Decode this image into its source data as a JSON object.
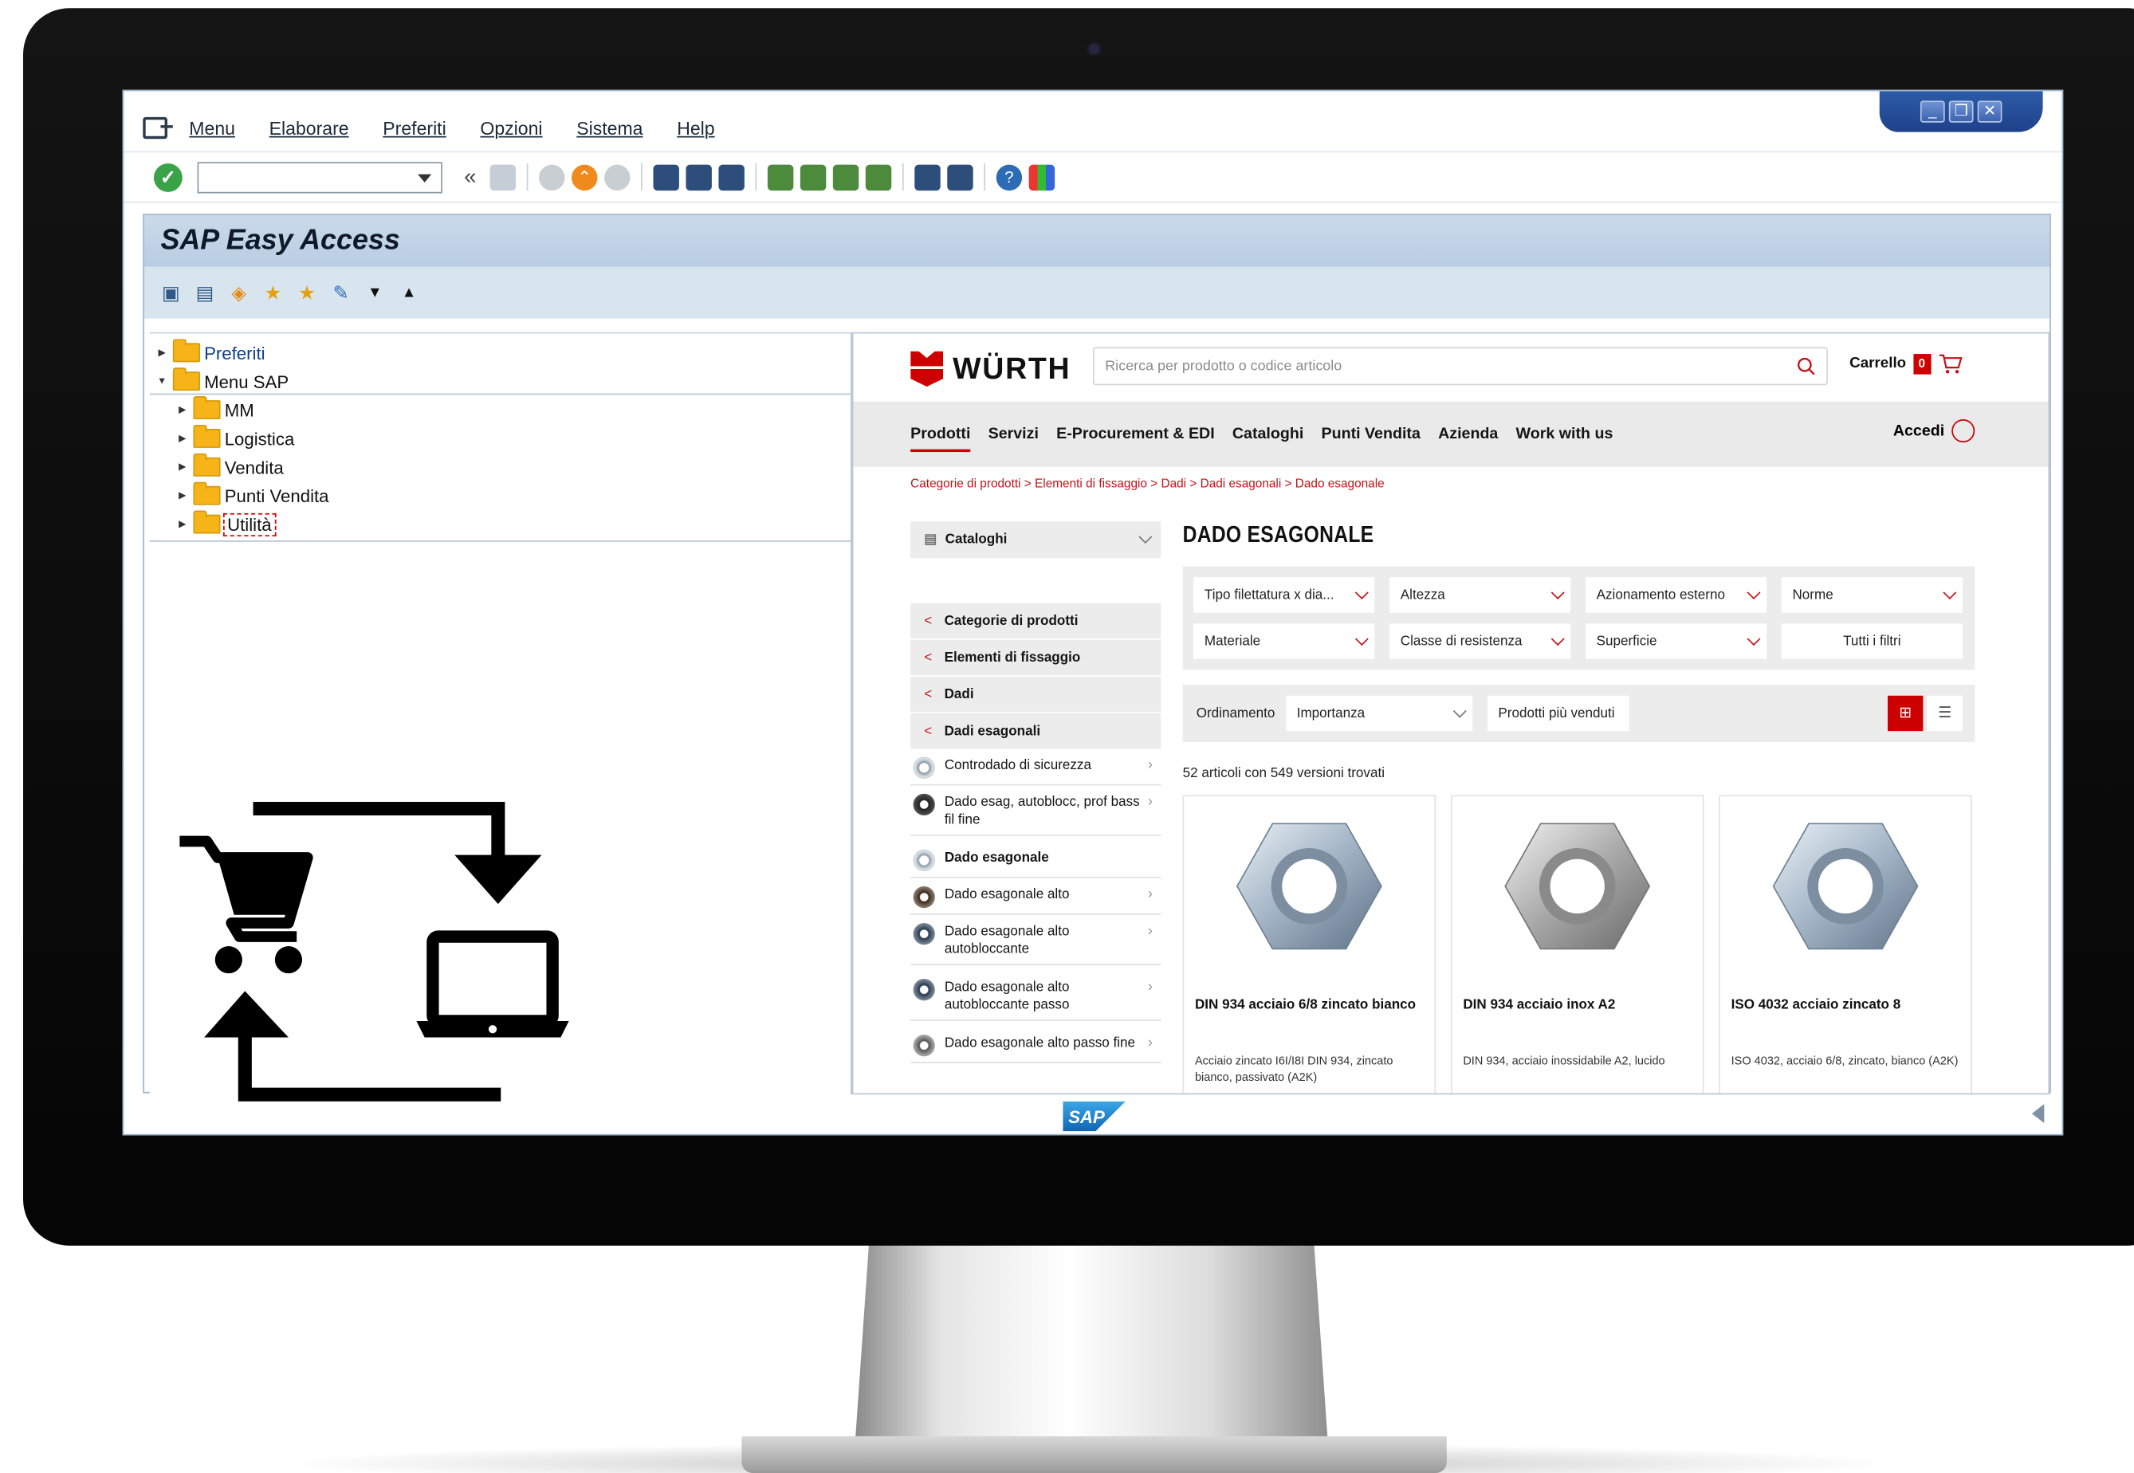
{
  "menubar": {
    "items": [
      "Menu",
      "Elaborare",
      "Preferiti",
      "Opzioni",
      "Sistema",
      "Help"
    ]
  },
  "sap": {
    "title": "SAP Easy Access",
    "tree": [
      {
        "label": "Preferiti",
        "level": 0,
        "open": false
      },
      {
        "label": "Menu SAP",
        "level": 0,
        "open": true
      },
      {
        "label": "MM",
        "level": 1,
        "open": false
      },
      {
        "label": "Logistica",
        "level": 1,
        "open": false
      },
      {
        "label": "Vendita",
        "level": 1,
        "open": false
      },
      {
        "label": "Punti Vendita",
        "level": 1,
        "open": false
      },
      {
        "label": "Utilità",
        "level": 1,
        "open": false
      }
    ],
    "logo": "SAP"
  },
  "web": {
    "logo_text": "WÜRTH",
    "search_placeholder": "Ricerca per prodotto o codice articolo",
    "cart_label": "Carrello",
    "cart_count": "0",
    "nav": [
      "Prodotti",
      "Servizi",
      "E-Procurement & EDI",
      "Cataloghi",
      "Punti Vendita",
      "Azienda",
      "Work with us"
    ],
    "login_label": "Accedi",
    "breadcrumb": "Categorie di prodotti  >  Elementi di fissaggio  >  Dadi  >  Dadi esagonali  >  Dado esagonale",
    "side_dropdown": "Cataloghi",
    "side_nav": [
      "Categorie di prodotti",
      "Elementi di fissaggio",
      "Dadi",
      "Dadi esagonali"
    ],
    "side_items": [
      "Controdado di sicurezza",
      "Dado esag, autoblocc, prof bass fil fine",
      "Dado esagonale",
      "Dado esagonale alto",
      "Dado esagonale alto autobloccante",
      "Dado esagonale alto autobloccante passo",
      "Dado esagonale alto passo fine"
    ],
    "heading": "DADO ESAGONALE",
    "filters": [
      "Tipo filettatura x dia...",
      "Altezza",
      "Azionamento esterno",
      "Norme",
      "Materiale",
      "Classe di resistenza",
      "Superficie",
      "Tutti i filtri"
    ],
    "sort_label": "Ordinamento",
    "sort_value": "Importanza",
    "bestsellers": "Prodotti più venduti",
    "result_count": "52 articoli con 549 versioni trovati",
    "products": [
      {
        "name": "DIN 934 acciaio 6/8 zincato bianco",
        "desc": "Acciaio zincato I6I/I8I DIN 934, zincato bianco, passivato (A2K)"
      },
      {
        "name": "DIN 934 acciaio inox A2",
        "desc": "DIN 934, acciaio inossidabile A2, lucido"
      },
      {
        "name": "ISO 4032 acciaio zincato 8",
        "desc": "ISO 4032, acciaio 6/8, zincato, bianco (A2K)"
      }
    ]
  },
  "colors": {
    "wurth_red": "#cc0000",
    "sap_blue": "#1f418a",
    "ok_green": "#3aa348"
  }
}
